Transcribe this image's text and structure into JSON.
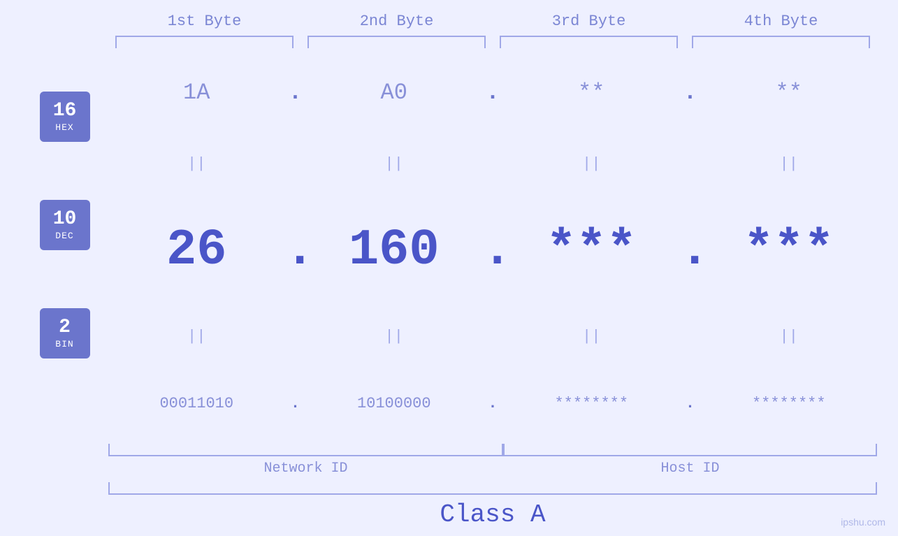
{
  "headers": {
    "byte1": "1st Byte",
    "byte2": "2nd Byte",
    "byte3": "3rd Byte",
    "byte4": "4th Byte"
  },
  "badges": {
    "hex": {
      "number": "16",
      "label": "HEX"
    },
    "dec": {
      "number": "10",
      "label": "DEC"
    },
    "bin": {
      "number": "2",
      "label": "BIN"
    }
  },
  "hex_row": {
    "byte1": "1A",
    "dot1": ".",
    "byte2": "A0",
    "dot2": ".",
    "byte3": "**",
    "dot3": ".",
    "byte4": "**"
  },
  "dec_row": {
    "byte1": "26",
    "dot1": ".",
    "byte2": "160",
    "dot2": ".",
    "byte3": "***",
    "dot3": ".",
    "byte4": "***"
  },
  "bin_row": {
    "byte1": "00011010",
    "dot1": ".",
    "byte2": "10100000",
    "dot2": ".",
    "byte3": "********",
    "dot3": ".",
    "byte4": "********"
  },
  "labels": {
    "network_id": "Network ID",
    "host_id": "Host ID",
    "class": "Class A"
  },
  "watermark": "ipshu.com",
  "equals": "||"
}
